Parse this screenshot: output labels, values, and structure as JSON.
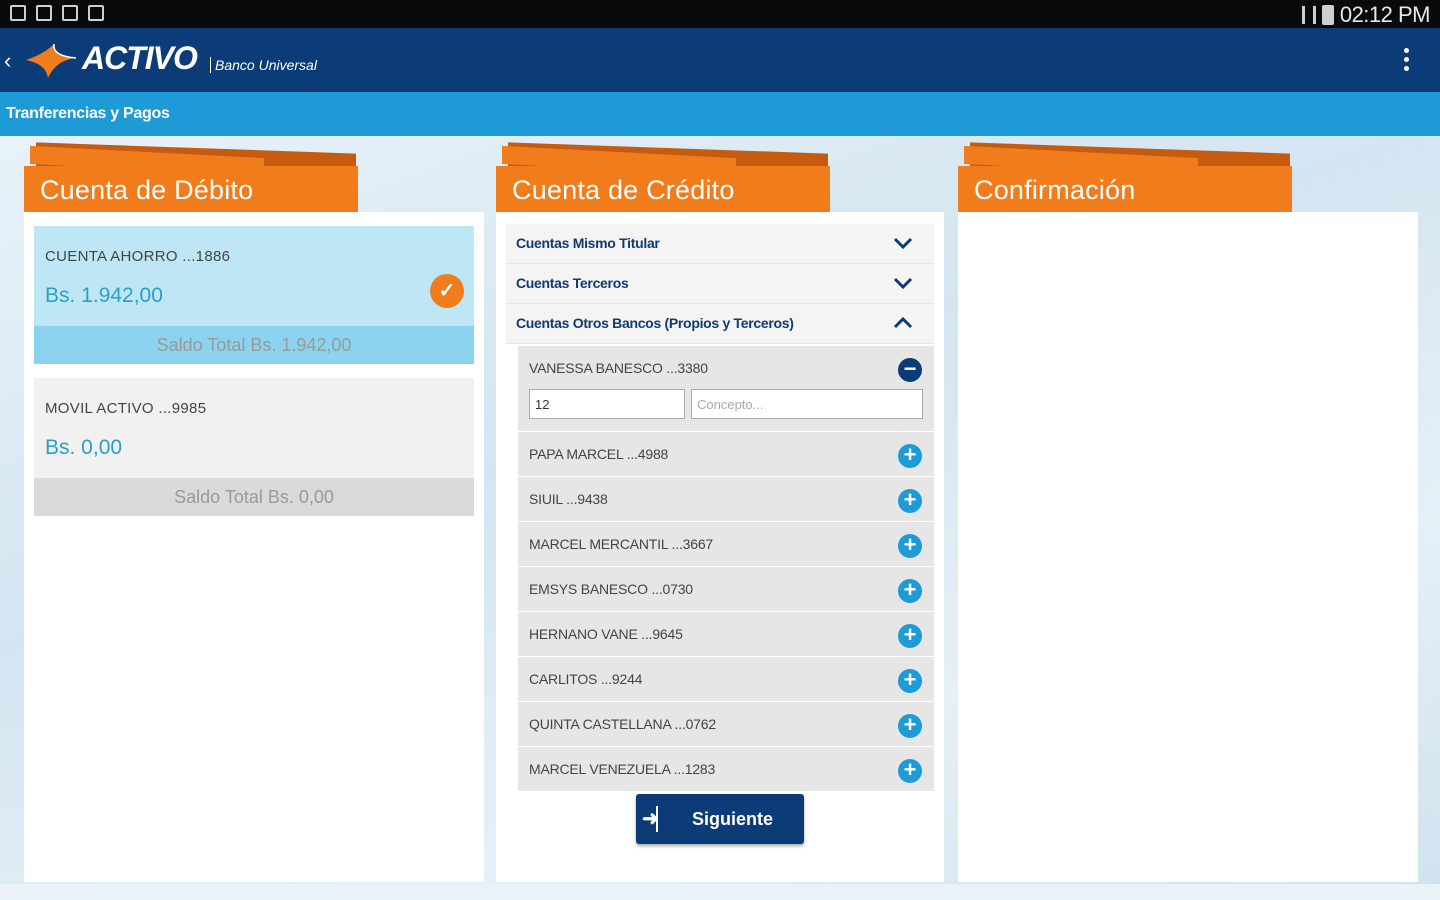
{
  "status_bar": {
    "time": "02:12 PM"
  },
  "app_bar": {
    "brand": "ACTIVO",
    "brand_sub": "Banco Universal"
  },
  "sub_bar": {
    "title": "Tranferencias y Pagos"
  },
  "panels": {
    "debit": {
      "title": "Cuenta de Débito",
      "accounts": [
        {
          "name": "CUENTA AHORRO ...1886",
          "amount": "Bs. 1.942,00",
          "total": "Saldo Total Bs. 1.942,00",
          "selected": true
        },
        {
          "name": "MOVIL ACTIVO ...9985",
          "amount": "Bs. 0,00",
          "total": "Saldo Total Bs. 0,00",
          "selected": false
        }
      ]
    },
    "credit": {
      "title": "Cuenta de Crédito",
      "groups": [
        {
          "label": "Cuentas Mismo Titular",
          "expanded": false
        },
        {
          "label": "Cuentas Terceros",
          "expanded": false
        },
        {
          "label": "Cuentas Otros Bancos (Propios y Terceros)",
          "expanded": true
        }
      ],
      "open_payee": {
        "name": "VANESSA BANESCO ...3380",
        "amount_value": "12",
        "concept_placeholder": "Concepto..."
      },
      "payees": [
        "PAPA MARCEL ...4988",
        "SIUIL ...9438",
        "MARCEL MERCANTIL ...3667",
        "EMSYS BANESCO ...0730",
        "HERNANO VANE ...9645",
        "CARLITOS ...9244",
        "QUINTA CASTELLANA ...0762",
        "MARCEL VENEZUELA ...1283"
      ],
      "next_label": "Siguiente"
    },
    "confirm": {
      "title": "Confirmación"
    }
  },
  "colors": {
    "navy": "#0b3c78",
    "blue": "#1e9ad6",
    "orange": "#f07c1c"
  }
}
